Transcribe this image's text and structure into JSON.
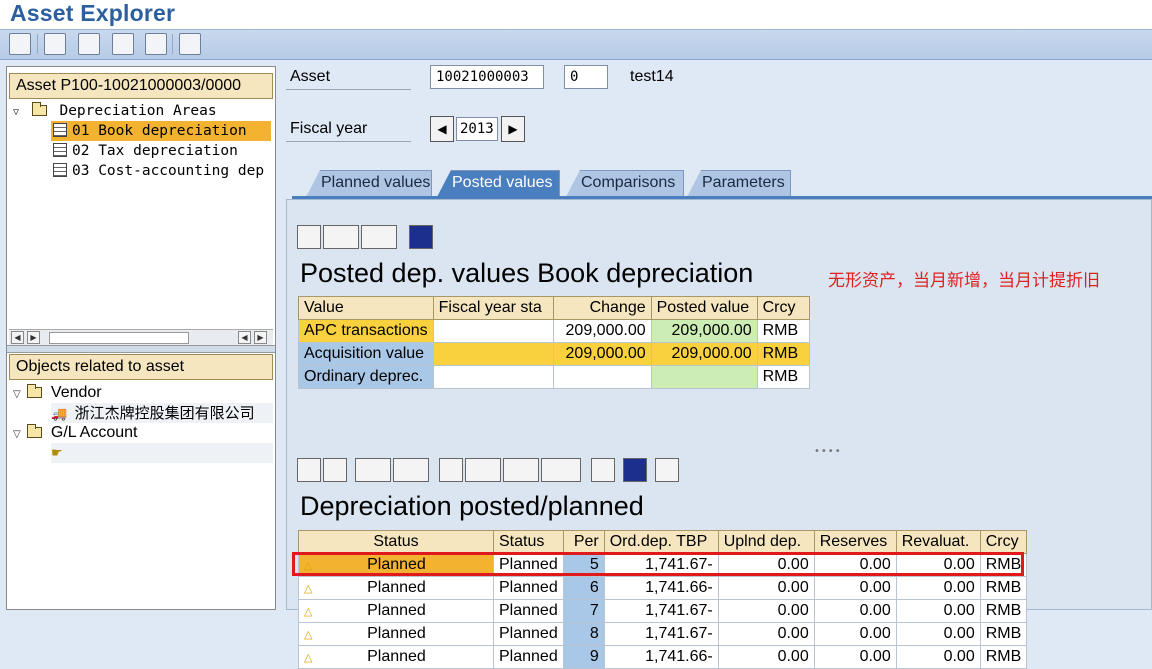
{
  "app": {
    "title": "Asset Explorer"
  },
  "toolbar": {
    "buttons": [
      "refresh-icon",
      "display-icon",
      "change-icon",
      "flow-icon",
      "org-icon",
      "list-icon"
    ]
  },
  "left": {
    "asset_header": "Asset P100-10021000003/0000",
    "depreciation_areas": "Depreciation Areas",
    "areas": [
      {
        "label": "01 Book depreciation"
      },
      {
        "label": "02 Tax depreciation"
      },
      {
        "label": "03 Cost-accounting dep"
      }
    ],
    "objects_header": "Objects related to asset",
    "vendor_label": "Vendor",
    "vendor_name": "浙江杰牌控股集团有限公司",
    "gl_label": "G/L Account"
  },
  "form": {
    "asset_label": "Asset",
    "asset_number": "10021000003",
    "sub_number": "0",
    "asset_desc": "test14",
    "fiscal_year_label": "Fiscal year",
    "fiscal_year": "2013"
  },
  "tabs": [
    {
      "label": "Planned values",
      "active": false
    },
    {
      "label": "Posted values",
      "active": true
    },
    {
      "label": "Comparisons",
      "active": false
    },
    {
      "label": "Parameters",
      "active": false
    }
  ],
  "posted": {
    "title": "Posted dep. values Book depreciation",
    "note": "无形资产，当月新增，当月计提折旧",
    "columns": [
      "Value",
      "Fiscal year sta",
      "Change",
      "Posted value",
      "Crcy"
    ],
    "rows": [
      {
        "value": "APC transactions",
        "fy_start": "",
        "change": "209,000.00",
        "posted": "209,000.00",
        "crcy": "RMB"
      },
      {
        "value": "Acquisition value",
        "fy_start": "",
        "change": "209,000.00",
        "posted": "209,000.00",
        "crcy": "RMB"
      },
      {
        "value": "Ordinary deprec.",
        "fy_start": "",
        "change": "",
        "posted": "",
        "crcy": "RMB"
      }
    ]
  },
  "dep": {
    "title": "Depreciation posted/planned",
    "columns": [
      "Status",
      "Status",
      "Per",
      "Ord.dep. TBP",
      "Uplnd dep.",
      "Reserves",
      "Revaluat.",
      "Crcy"
    ],
    "rows": [
      {
        "status_icon": "Planned",
        "status": "Planned",
        "per": "5",
        "ord": "1,741.67-",
        "uplnd": "0.00",
        "reserves": "0.00",
        "reval": "0.00",
        "crcy": "RMB"
      },
      {
        "status_icon": "Planned",
        "status": "Planned",
        "per": "6",
        "ord": "1,741.66-",
        "uplnd": "0.00",
        "reserves": "0.00",
        "reval": "0.00",
        "crcy": "RMB"
      },
      {
        "status_icon": "Planned",
        "status": "Planned",
        "per": "7",
        "ord": "1,741.67-",
        "uplnd": "0.00",
        "reserves": "0.00",
        "reval": "0.00",
        "crcy": "RMB"
      },
      {
        "status_icon": "Planned",
        "status": "Planned",
        "per": "8",
        "ord": "1,741.67-",
        "uplnd": "0.00",
        "reserves": "0.00",
        "reval": "0.00",
        "crcy": "RMB"
      },
      {
        "status_icon": "Planned",
        "status": "Planned",
        "per": "9",
        "ord": "1,741.66-",
        "uplnd": "0.00",
        "reserves": "0.00",
        "reval": "0.00",
        "crcy": "RMB"
      }
    ]
  },
  "colors": {
    "accent": "#4a7fbf",
    "highlight": "#e0191b",
    "yellow": "#f9d13f",
    "green": "#cceeb4",
    "header": "#f5e6bf"
  }
}
